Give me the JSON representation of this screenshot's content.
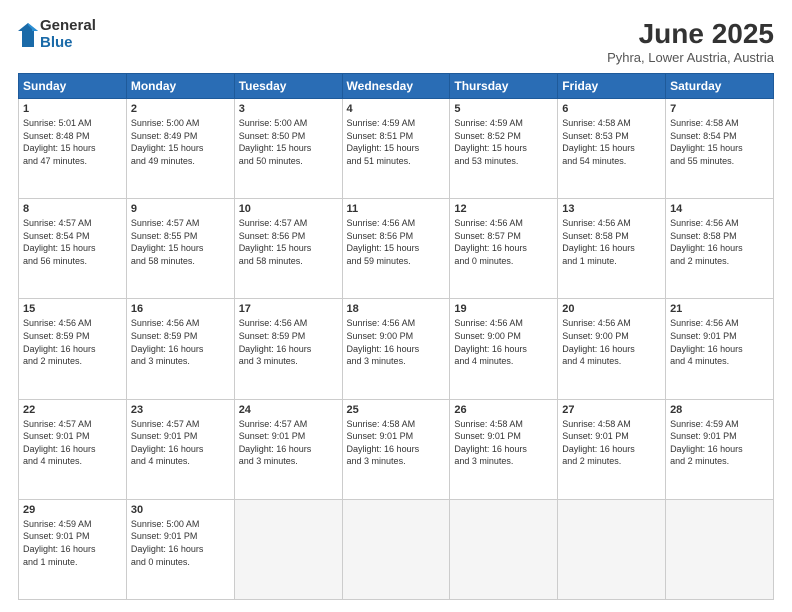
{
  "logo": {
    "general": "General",
    "blue": "Blue"
  },
  "title": "June 2025",
  "subtitle": "Pyhra, Lower Austria, Austria",
  "headers": [
    "Sunday",
    "Monday",
    "Tuesday",
    "Wednesday",
    "Thursday",
    "Friday",
    "Saturday"
  ],
  "weeks": [
    [
      {
        "day": "1",
        "info": "Sunrise: 5:01 AM\nSunset: 8:48 PM\nDaylight: 15 hours\nand 47 minutes."
      },
      {
        "day": "2",
        "info": "Sunrise: 5:00 AM\nSunset: 8:49 PM\nDaylight: 15 hours\nand 49 minutes."
      },
      {
        "day": "3",
        "info": "Sunrise: 5:00 AM\nSunset: 8:50 PM\nDaylight: 15 hours\nand 50 minutes."
      },
      {
        "day": "4",
        "info": "Sunrise: 4:59 AM\nSunset: 8:51 PM\nDaylight: 15 hours\nand 51 minutes."
      },
      {
        "day": "5",
        "info": "Sunrise: 4:59 AM\nSunset: 8:52 PM\nDaylight: 15 hours\nand 53 minutes."
      },
      {
        "day": "6",
        "info": "Sunrise: 4:58 AM\nSunset: 8:53 PM\nDaylight: 15 hours\nand 54 minutes."
      },
      {
        "day": "7",
        "info": "Sunrise: 4:58 AM\nSunset: 8:54 PM\nDaylight: 15 hours\nand 55 minutes."
      }
    ],
    [
      {
        "day": "8",
        "info": "Sunrise: 4:57 AM\nSunset: 8:54 PM\nDaylight: 15 hours\nand 56 minutes."
      },
      {
        "day": "9",
        "info": "Sunrise: 4:57 AM\nSunset: 8:55 PM\nDaylight: 15 hours\nand 58 minutes."
      },
      {
        "day": "10",
        "info": "Sunrise: 4:57 AM\nSunset: 8:56 PM\nDaylight: 15 hours\nand 58 minutes."
      },
      {
        "day": "11",
        "info": "Sunrise: 4:56 AM\nSunset: 8:56 PM\nDaylight: 15 hours\nand 59 minutes."
      },
      {
        "day": "12",
        "info": "Sunrise: 4:56 AM\nSunset: 8:57 PM\nDaylight: 16 hours\nand 0 minutes."
      },
      {
        "day": "13",
        "info": "Sunrise: 4:56 AM\nSunset: 8:58 PM\nDaylight: 16 hours\nand 1 minute."
      },
      {
        "day": "14",
        "info": "Sunrise: 4:56 AM\nSunset: 8:58 PM\nDaylight: 16 hours\nand 2 minutes."
      }
    ],
    [
      {
        "day": "15",
        "info": "Sunrise: 4:56 AM\nSunset: 8:59 PM\nDaylight: 16 hours\nand 2 minutes."
      },
      {
        "day": "16",
        "info": "Sunrise: 4:56 AM\nSunset: 8:59 PM\nDaylight: 16 hours\nand 3 minutes."
      },
      {
        "day": "17",
        "info": "Sunrise: 4:56 AM\nSunset: 8:59 PM\nDaylight: 16 hours\nand 3 minutes."
      },
      {
        "day": "18",
        "info": "Sunrise: 4:56 AM\nSunset: 9:00 PM\nDaylight: 16 hours\nand 3 minutes."
      },
      {
        "day": "19",
        "info": "Sunrise: 4:56 AM\nSunset: 9:00 PM\nDaylight: 16 hours\nand 4 minutes."
      },
      {
        "day": "20",
        "info": "Sunrise: 4:56 AM\nSunset: 9:00 PM\nDaylight: 16 hours\nand 4 minutes."
      },
      {
        "day": "21",
        "info": "Sunrise: 4:56 AM\nSunset: 9:01 PM\nDaylight: 16 hours\nand 4 minutes."
      }
    ],
    [
      {
        "day": "22",
        "info": "Sunrise: 4:57 AM\nSunset: 9:01 PM\nDaylight: 16 hours\nand 4 minutes."
      },
      {
        "day": "23",
        "info": "Sunrise: 4:57 AM\nSunset: 9:01 PM\nDaylight: 16 hours\nand 4 minutes."
      },
      {
        "day": "24",
        "info": "Sunrise: 4:57 AM\nSunset: 9:01 PM\nDaylight: 16 hours\nand 3 minutes."
      },
      {
        "day": "25",
        "info": "Sunrise: 4:58 AM\nSunset: 9:01 PM\nDaylight: 16 hours\nand 3 minutes."
      },
      {
        "day": "26",
        "info": "Sunrise: 4:58 AM\nSunset: 9:01 PM\nDaylight: 16 hours\nand 3 minutes."
      },
      {
        "day": "27",
        "info": "Sunrise: 4:58 AM\nSunset: 9:01 PM\nDaylight: 16 hours\nand 2 minutes."
      },
      {
        "day": "28",
        "info": "Sunrise: 4:59 AM\nSunset: 9:01 PM\nDaylight: 16 hours\nand 2 minutes."
      }
    ],
    [
      {
        "day": "29",
        "info": "Sunrise: 4:59 AM\nSunset: 9:01 PM\nDaylight: 16 hours\nand 1 minute."
      },
      {
        "day": "30",
        "info": "Sunrise: 5:00 AM\nSunset: 9:01 PM\nDaylight: 16 hours\nand 0 minutes."
      },
      null,
      null,
      null,
      null,
      null
    ]
  ]
}
